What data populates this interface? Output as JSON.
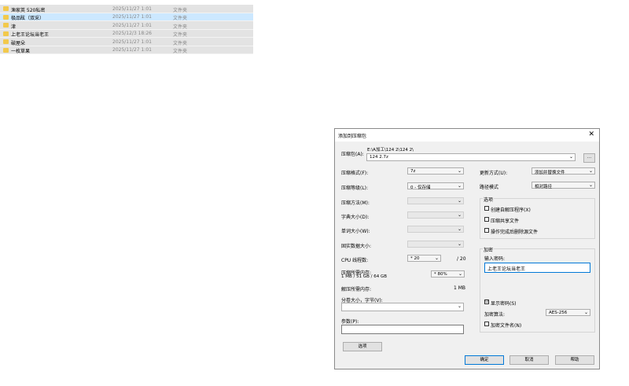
{
  "files": [
    {
      "name": "渔家英  520私密",
      "date": "2025/11/27 1:01",
      "type": "文件夹",
      "selected": false
    },
    {
      "name": "极品眩（双采）",
      "date": "2025/11/27 1:01",
      "type": "文件夹",
      "selected": true
    },
    {
      "name": "津",
      "date": "2025/11/27 1:01",
      "type": "文件夹",
      "selected": false
    },
    {
      "name": "上老王论坛当老王",
      "date": "2025/12/3 18:26",
      "type": "文件夹",
      "selected": false
    },
    {
      "name": "破屋朵",
      "date": "2025/11/27 1:01",
      "type": "文件夹",
      "selected": false
    },
    {
      "name": "一枚草果",
      "date": "2025/11/27 1:01",
      "type": "文件夹",
      "selected": false
    }
  ],
  "dialog": {
    "title": "添加到压缩包",
    "close": "✕",
    "archive_label": "压缩包(A):",
    "archive_path": "E:\\A加工\\124 2\\124 2\\",
    "archive_name": "124 2.7z",
    "browse": "...",
    "left": {
      "format_label": "压缩格式(F):",
      "format_value": "7z",
      "level_label": "压缩等级(L):",
      "level_value": "0 - 仅存储",
      "method_label": "压缩方法(M):",
      "dict_label": "字典大小(D):",
      "word_label": "单词大小(W):",
      "solid_label": "固实数据大小:",
      "threads_label": "CPU 线程数:",
      "threads_value": "* 20",
      "threads_total": "/ 20",
      "mem_comp_label": "压缩所需内存:",
      "mem_comp_detail": "1 MB / 51 GB / 64 GB",
      "mem_comp_value": "* 80%",
      "mem_decomp_label": "解压所需内存:",
      "mem_decomp_value": "1 MB",
      "split_label": "分卷大小，字节(V):",
      "params_label": "参数(P):",
      "options_btn": "选项"
    },
    "right": {
      "update_label": "更新方式(U):",
      "update_value": "添加并替换文件",
      "path_label": "路径模式",
      "path_value": "相对路径",
      "options_group": "选项",
      "opt_sfx": "创建自解压程序(X)",
      "opt_shared": "压缩共享文件",
      "opt_delete": "操作完成后删除源文件",
      "enc_group": "加密",
      "pwd_label": "输入密码:",
      "pwd_value": "上老王论坛当老王",
      "show_pwd": "显示密码(S)",
      "show_pwd_check": "☑",
      "enc_method_label": "加密算法:",
      "enc_method_value": "AES-256",
      "enc_names": "加密文件名(N)"
    },
    "buttons": {
      "ok": "确定",
      "cancel": "取消",
      "help": "帮助"
    }
  }
}
